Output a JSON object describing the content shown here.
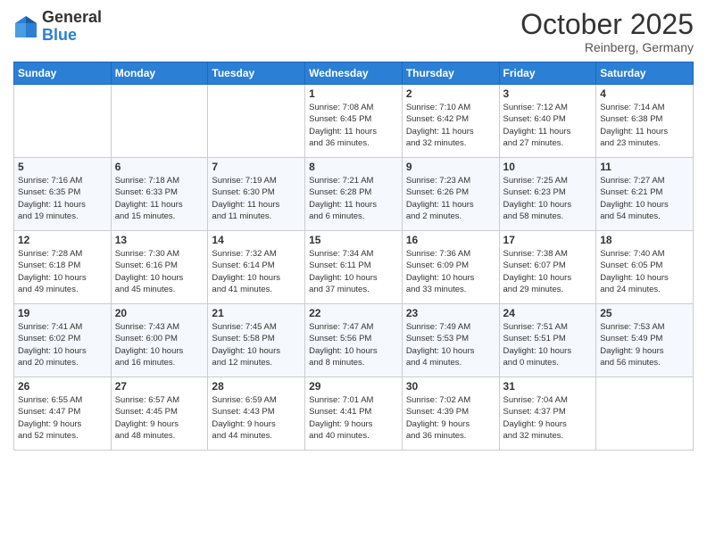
{
  "header": {
    "logo_general": "General",
    "logo_blue": "Blue",
    "month": "October 2025",
    "location": "Reinberg, Germany"
  },
  "days_of_week": [
    "Sunday",
    "Monday",
    "Tuesday",
    "Wednesday",
    "Thursday",
    "Friday",
    "Saturday"
  ],
  "weeks": [
    [
      {
        "day": "",
        "info": ""
      },
      {
        "day": "",
        "info": ""
      },
      {
        "day": "",
        "info": ""
      },
      {
        "day": "1",
        "info": "Sunrise: 7:08 AM\nSunset: 6:45 PM\nDaylight: 11 hours\nand 36 minutes."
      },
      {
        "day": "2",
        "info": "Sunrise: 7:10 AM\nSunset: 6:42 PM\nDaylight: 11 hours\nand 32 minutes."
      },
      {
        "day": "3",
        "info": "Sunrise: 7:12 AM\nSunset: 6:40 PM\nDaylight: 11 hours\nand 27 minutes."
      },
      {
        "day": "4",
        "info": "Sunrise: 7:14 AM\nSunset: 6:38 PM\nDaylight: 11 hours\nand 23 minutes."
      }
    ],
    [
      {
        "day": "5",
        "info": "Sunrise: 7:16 AM\nSunset: 6:35 PM\nDaylight: 11 hours\nand 19 minutes."
      },
      {
        "day": "6",
        "info": "Sunrise: 7:18 AM\nSunset: 6:33 PM\nDaylight: 11 hours\nand 15 minutes."
      },
      {
        "day": "7",
        "info": "Sunrise: 7:19 AM\nSunset: 6:30 PM\nDaylight: 11 hours\nand 11 minutes."
      },
      {
        "day": "8",
        "info": "Sunrise: 7:21 AM\nSunset: 6:28 PM\nDaylight: 11 hours\nand 6 minutes."
      },
      {
        "day": "9",
        "info": "Sunrise: 7:23 AM\nSunset: 6:26 PM\nDaylight: 11 hours\nand 2 minutes."
      },
      {
        "day": "10",
        "info": "Sunrise: 7:25 AM\nSunset: 6:23 PM\nDaylight: 10 hours\nand 58 minutes."
      },
      {
        "day": "11",
        "info": "Sunrise: 7:27 AM\nSunset: 6:21 PM\nDaylight: 10 hours\nand 54 minutes."
      }
    ],
    [
      {
        "day": "12",
        "info": "Sunrise: 7:28 AM\nSunset: 6:18 PM\nDaylight: 10 hours\nand 49 minutes."
      },
      {
        "day": "13",
        "info": "Sunrise: 7:30 AM\nSunset: 6:16 PM\nDaylight: 10 hours\nand 45 minutes."
      },
      {
        "day": "14",
        "info": "Sunrise: 7:32 AM\nSunset: 6:14 PM\nDaylight: 10 hours\nand 41 minutes."
      },
      {
        "day": "15",
        "info": "Sunrise: 7:34 AM\nSunset: 6:11 PM\nDaylight: 10 hours\nand 37 minutes."
      },
      {
        "day": "16",
        "info": "Sunrise: 7:36 AM\nSunset: 6:09 PM\nDaylight: 10 hours\nand 33 minutes."
      },
      {
        "day": "17",
        "info": "Sunrise: 7:38 AM\nSunset: 6:07 PM\nDaylight: 10 hours\nand 29 minutes."
      },
      {
        "day": "18",
        "info": "Sunrise: 7:40 AM\nSunset: 6:05 PM\nDaylight: 10 hours\nand 24 minutes."
      }
    ],
    [
      {
        "day": "19",
        "info": "Sunrise: 7:41 AM\nSunset: 6:02 PM\nDaylight: 10 hours\nand 20 minutes."
      },
      {
        "day": "20",
        "info": "Sunrise: 7:43 AM\nSunset: 6:00 PM\nDaylight: 10 hours\nand 16 minutes."
      },
      {
        "day": "21",
        "info": "Sunrise: 7:45 AM\nSunset: 5:58 PM\nDaylight: 10 hours\nand 12 minutes."
      },
      {
        "day": "22",
        "info": "Sunrise: 7:47 AM\nSunset: 5:56 PM\nDaylight: 10 hours\nand 8 minutes."
      },
      {
        "day": "23",
        "info": "Sunrise: 7:49 AM\nSunset: 5:53 PM\nDaylight: 10 hours\nand 4 minutes."
      },
      {
        "day": "24",
        "info": "Sunrise: 7:51 AM\nSunset: 5:51 PM\nDaylight: 10 hours\nand 0 minutes."
      },
      {
        "day": "25",
        "info": "Sunrise: 7:53 AM\nSunset: 5:49 PM\nDaylight: 9 hours\nand 56 minutes."
      }
    ],
    [
      {
        "day": "26",
        "info": "Sunrise: 6:55 AM\nSunset: 4:47 PM\nDaylight: 9 hours\nand 52 minutes."
      },
      {
        "day": "27",
        "info": "Sunrise: 6:57 AM\nSunset: 4:45 PM\nDaylight: 9 hours\nand 48 minutes."
      },
      {
        "day": "28",
        "info": "Sunrise: 6:59 AM\nSunset: 4:43 PM\nDaylight: 9 hours\nand 44 minutes."
      },
      {
        "day": "29",
        "info": "Sunrise: 7:01 AM\nSunset: 4:41 PM\nDaylight: 9 hours\nand 40 minutes."
      },
      {
        "day": "30",
        "info": "Sunrise: 7:02 AM\nSunset: 4:39 PM\nDaylight: 9 hours\nand 36 minutes."
      },
      {
        "day": "31",
        "info": "Sunrise: 7:04 AM\nSunset: 4:37 PM\nDaylight: 9 hours\nand 32 minutes."
      },
      {
        "day": "",
        "info": ""
      }
    ]
  ]
}
